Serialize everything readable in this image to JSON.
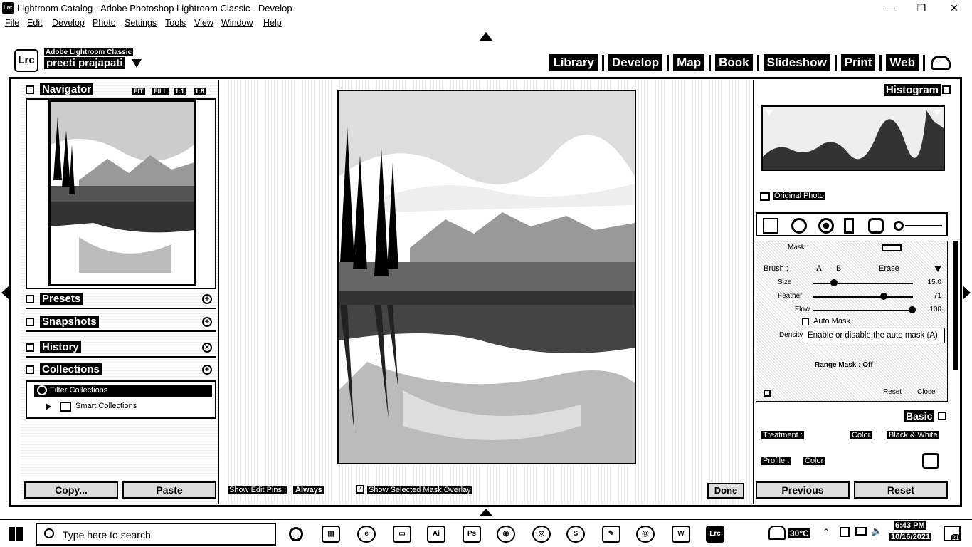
{
  "window": {
    "title": "Lightroom Catalog - Adobe Photoshop Lightroom Classic - Develop",
    "app_icon": "Lrc",
    "minimize": "—",
    "maximize": "❐",
    "close": "✕"
  },
  "menu": [
    "File",
    "Edit",
    "Develop",
    "Photo",
    "Settings",
    "Tools",
    "View",
    "Window",
    "Help"
  ],
  "identity": {
    "logo": "Lrc",
    "brand": "Adobe Lightroom Classic",
    "user": "preeti prajapati"
  },
  "modules": [
    "Library",
    "Develop",
    "Map",
    "Book",
    "Slideshow",
    "Print",
    "Web"
  ],
  "left_panel": {
    "navigator": {
      "label": "Navigator",
      "zoom": [
        "FIT",
        "FILL",
        "1:1",
        "1:8"
      ]
    },
    "presets": {
      "label": "Presets"
    },
    "snapshots": {
      "label": "Snapshots"
    },
    "history": {
      "label": "History"
    },
    "collections": {
      "label": "Collections",
      "filter": "Filter Collections",
      "smart": "Smart Collections"
    },
    "copy": "Copy...",
    "paste": "Paste"
  },
  "center": {
    "show_edit_pins_label": "Show Edit Pins :",
    "show_edit_pins_value": "Always",
    "overlay_label": "Show Selected Mask Overlay",
    "done": "Done"
  },
  "right_panel": {
    "histogram": "Histogram",
    "original_photo": "Original Photo",
    "brush": {
      "mask_title": "Mask :",
      "label": "Brush :",
      "a": "A",
      "b": "B",
      "erase": "Erase",
      "sliders": [
        {
          "name": "Size",
          "value": "15.0",
          "level": 0.18
        },
        {
          "name": "Feather",
          "value": "71",
          "level": 0.71
        },
        {
          "name": "Flow",
          "value": "100",
          "level": 1.0
        }
      ],
      "auto_mask": "Auto Mask",
      "density": "Density",
      "range_mask": "Range Mask : Off",
      "reset": "Reset",
      "close": "Close"
    },
    "tooltip": "Enable or disable the auto mask (A)",
    "basic": {
      "label": "Basic",
      "treatment": "Treatment :",
      "color": "Color",
      "bw": "Black & White",
      "profile": "Profile :",
      "profile_value": "Color"
    },
    "previous": "Previous",
    "reset": "Reset"
  },
  "taskbar": {
    "search_placeholder": "Type here to search",
    "temperature": "30°C",
    "time": "6:43 PM",
    "date": "10/16/2021",
    "notif": "21"
  }
}
